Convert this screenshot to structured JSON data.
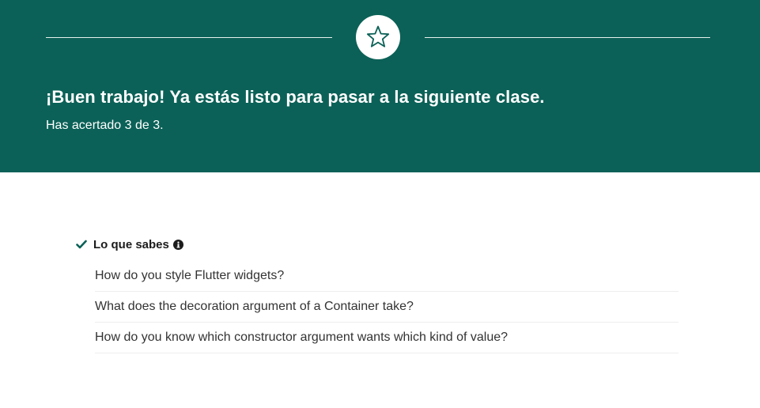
{
  "result": {
    "headline": "¡Buen trabajo! Ya estás listo para pasar a la siguiente clase.",
    "score_text": "Has acertado 3 de 3."
  },
  "known_section": {
    "title": "Lo que sabes",
    "questions": [
      "How do you style Flutter widgets?",
      "What does the decoration argument of a Container take?",
      "How do you know which constructor argument wants which kind of value?"
    ]
  },
  "icons": {
    "badge": "star-icon",
    "section_status": "check-icon",
    "section_info": "info-icon"
  },
  "colors": {
    "banner": "#0b6157",
    "accent": "#0b6157",
    "text": "#1c1c1c"
  }
}
